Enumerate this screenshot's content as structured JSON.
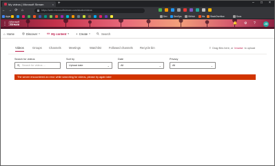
{
  "browser": {
    "tab_title": "My videos | Microsoft Stream",
    "tab_close": "×",
    "new_tab": "+",
    "window_controls": [
      "–",
      "□",
      "×"
    ],
    "nav_buttons": [
      "←",
      "→",
      "⟳",
      "⌂"
    ],
    "url": "https://web.microsoftstream.com/studio/videos",
    "bookmarks": [
      "Apps",
      "",
      "",
      "",
      "",
      "",
      "",
      "",
      "",
      "",
      "",
      "",
      "",
      "",
      "",
      "",
      "",
      "",
      "",
      "",
      "Dev",
      "DevOps",
      "GitHub",
      "Ms",
      "StackOverflow",
      "Docs"
    ]
  },
  "header": {
    "brand_company": "Microsoft",
    "brand_product": "Stream",
    "avatar_initials": "JG"
  },
  "appnav": {
    "home": "Home",
    "discover": "Discover",
    "my_content": "My content",
    "create": "Create",
    "search": "Search"
  },
  "pivot": {
    "tabs": [
      "Videos",
      "Groups",
      "Channels",
      "Meetings",
      "Watchlist",
      "Followed channels",
      "Recycle bin"
    ]
  },
  "upload_hint": {
    "prefix": "Drag files here, or",
    "link": "browse",
    "suffix": "to upload"
  },
  "filters": {
    "search_label": "Search for videos",
    "search_placeholder": "Search for videos ...",
    "sort_label": "Sort by",
    "sort_value": "Upload date",
    "date_label": "Date",
    "date_value": "All",
    "privacy_label": "Privacy",
    "privacy_value": "All"
  },
  "error": {
    "message": "The server encountered an error while searching for videos, please try again later"
  },
  "colors": {
    "accent": "#bc1948",
    "error": "#d13400",
    "browser_dark": "#35363a"
  }
}
